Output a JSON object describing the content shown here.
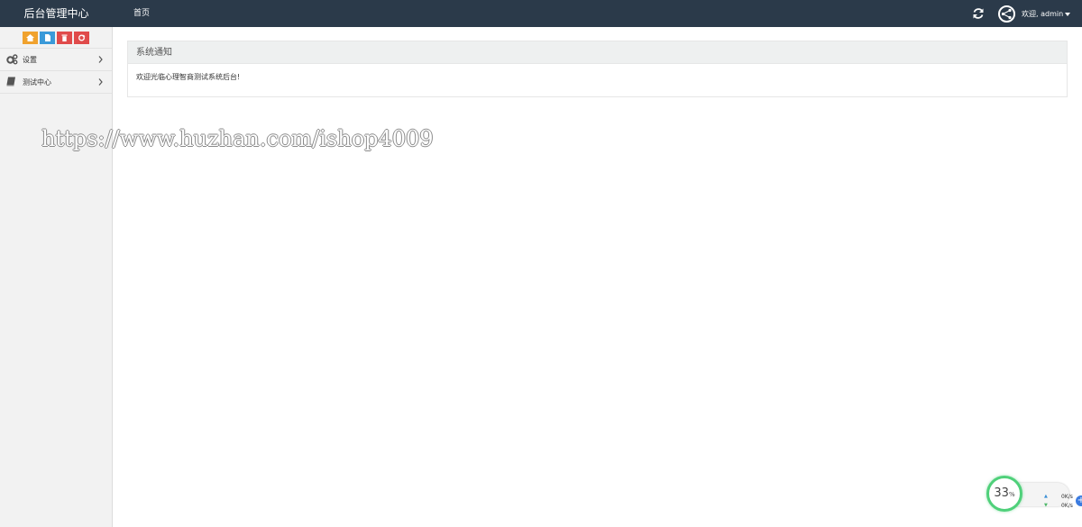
{
  "topbar": {
    "brand": "后台管理中心",
    "home_link": "首页",
    "user_menu": "欢迎, admin"
  },
  "sidebar": {
    "shortcuts": [
      {
        "name": "home",
        "color": "#f0a22e"
      },
      {
        "name": "document",
        "color": "#3a9ad9"
      },
      {
        "name": "trash",
        "color": "#e04b4b"
      },
      {
        "name": "recycle",
        "color": "#e04b4b"
      }
    ],
    "items": [
      {
        "label": "设置",
        "icon": "gears-icon"
      },
      {
        "label": "测试中心",
        "icon": "book-icon"
      }
    ]
  },
  "notice": {
    "title": "系统通知",
    "body": "欢迎光临心理智商测试系统后台!"
  },
  "watermark": "https://www.huzhan.com/ishop4009",
  "speed_widget": {
    "percent": "33",
    "percent_unit": "%",
    "upload": "0K/s",
    "download": "0K/s",
    "accent": "#4fd07a"
  }
}
